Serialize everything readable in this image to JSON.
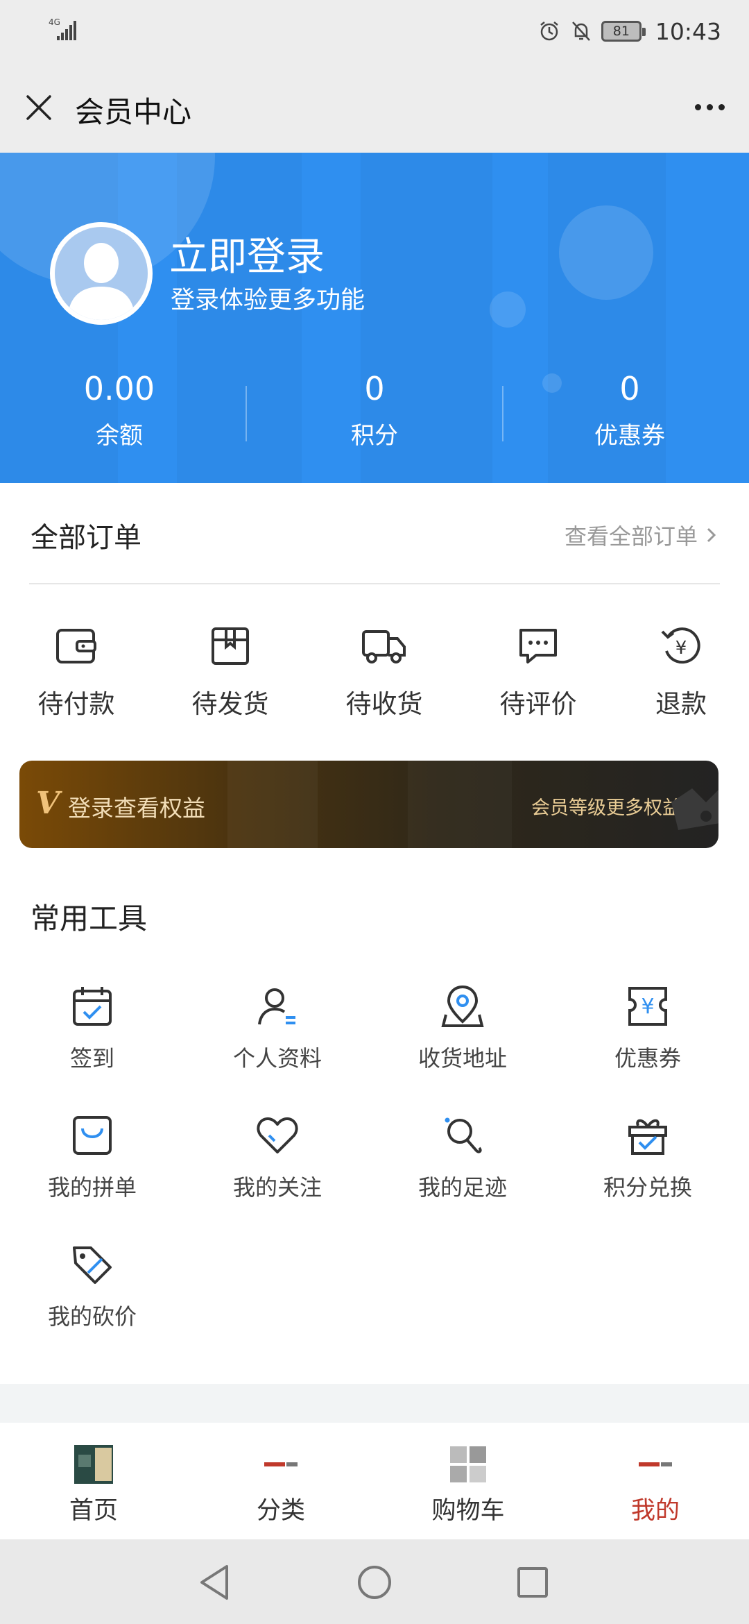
{
  "status_bar": {
    "network": "4G",
    "battery": "81",
    "time": "10:43"
  },
  "title_bar": {
    "title": "会员中心"
  },
  "header": {
    "login_title": "立即登录",
    "login_subtitle": "登录体验更多功能",
    "stats": [
      {
        "value": "0.00",
        "label": "余额"
      },
      {
        "value": "0",
        "label": "积分"
      },
      {
        "value": "0",
        "label": "优惠券"
      }
    ],
    "accent_color": "#2f8ff0"
  },
  "orders": {
    "title": "全部订单",
    "view_all": "查看全部订单",
    "items": [
      {
        "label": "待付款",
        "icon": "wallet-icon"
      },
      {
        "label": "待发货",
        "icon": "package-icon"
      },
      {
        "label": "待收货",
        "icon": "truck-icon"
      },
      {
        "label": "待评价",
        "icon": "comment-icon"
      },
      {
        "label": "退款",
        "icon": "refund-icon"
      }
    ]
  },
  "benefits": {
    "mark": "V",
    "left_text": "登录查看权益",
    "right_text": "会员等级更多权益"
  },
  "tools": {
    "title": "常用工具",
    "items": [
      {
        "label": "签到",
        "icon": "calendar-check-icon"
      },
      {
        "label": "个人资料",
        "icon": "user-profile-icon"
      },
      {
        "label": "收货地址",
        "icon": "location-pin-icon"
      },
      {
        "label": "优惠券",
        "icon": "coupon-icon"
      },
      {
        "label": "我的拼单",
        "icon": "shopping-bag-icon"
      },
      {
        "label": "我的关注",
        "icon": "heart-icon"
      },
      {
        "label": "我的足迹",
        "icon": "footprint-icon"
      },
      {
        "label": "积分兑换",
        "icon": "gift-icon"
      },
      {
        "label": "我的砍价",
        "icon": "discount-tag-icon"
      }
    ]
  },
  "bottom_nav": {
    "items": [
      {
        "label": "首页",
        "active": false
      },
      {
        "label": "分类",
        "active": false
      },
      {
        "label": "购物车",
        "active": false
      },
      {
        "label": "我的",
        "active": true
      }
    ],
    "active_color": "#c0392b"
  }
}
